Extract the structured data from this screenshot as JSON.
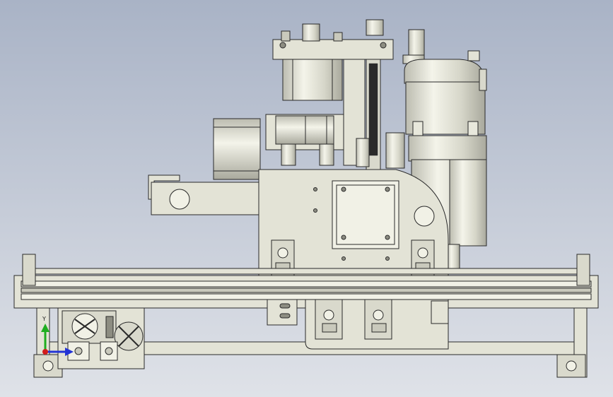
{
  "viewport": {
    "background_top": "#a9b3c6",
    "background_bottom": "#dfe2e8"
  },
  "colors": {
    "part_fill": "#e3e3d6",
    "part_fill_dark": "#c9c9bc",
    "part_fill_light": "#f1f1e6",
    "edge": "#2a2a2a",
    "shadow": "#8d8d82"
  },
  "triad": {
    "x_axis_color": "#d31c1c",
    "y_axis_color": "#1fae1f",
    "z_axis_color": "#2233d6",
    "y_label": "Y"
  }
}
